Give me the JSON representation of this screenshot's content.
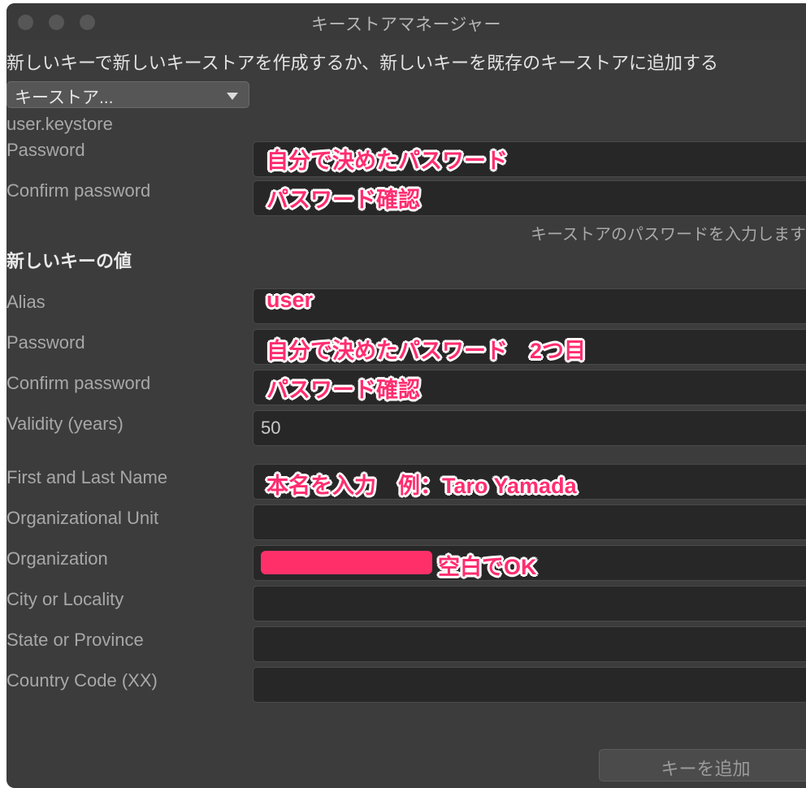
{
  "window": {
    "title": "キーストアマネージャー",
    "traffic_lights": [
      "close",
      "minimize",
      "zoom"
    ]
  },
  "header": {
    "description": "新しいキーで新しいキーストアを作成するか、新しいキーを既存のキーストアに追加する"
  },
  "keystore_select": {
    "label": "キーストア...",
    "icon": "chevron-down-icon"
  },
  "keystore_section": {
    "filename": "user.keystore",
    "rows": [
      {
        "label": "Password",
        "value": "",
        "annotation": "自分で決めたパスワード"
      },
      {
        "label": "Confirm password",
        "value": "",
        "annotation": "パスワード確認"
      }
    ],
    "hint": "キーストアのパスワードを入力します"
  },
  "key_section": {
    "heading": "新しいキーの値",
    "rows": [
      {
        "label": "Alias",
        "value": "",
        "annotation": "user"
      },
      {
        "label": "Password",
        "value": "",
        "annotation": "自分で決めたパスワード　2つ目"
      },
      {
        "label": "Confirm password",
        "value": "",
        "annotation": "パスワード確認"
      },
      {
        "label": "Validity (years)",
        "value": "50",
        "annotation": ""
      }
    ]
  },
  "certificate_section": {
    "rows": [
      {
        "label": "First and Last Name",
        "value": "",
        "annotation": "本名を入力　例：Taro Yamada"
      },
      {
        "label": "Organizational Unit",
        "value": "",
        "annotation": ""
      },
      {
        "label": "Organization",
        "value": "",
        "annotation": "空白でOK",
        "redaction_bar": true
      },
      {
        "label": "City or Locality",
        "value": "",
        "annotation": ""
      },
      {
        "label": "State or Province",
        "value": "",
        "annotation": ""
      },
      {
        "label": "Country Code (XX)",
        "value": "",
        "annotation": ""
      }
    ]
  },
  "footer": {
    "add_key_label": "キーを追加"
  },
  "colors": {
    "window_bg": "#3c3c3c",
    "titlebar_bg": "#3a3a3a",
    "field_bg": "#272727",
    "label_text": "#a8a8a8",
    "accent_pink": "#ff2d6f",
    "redaction_pink": "#ff3069",
    "button_bg": "#4b4b4b"
  }
}
